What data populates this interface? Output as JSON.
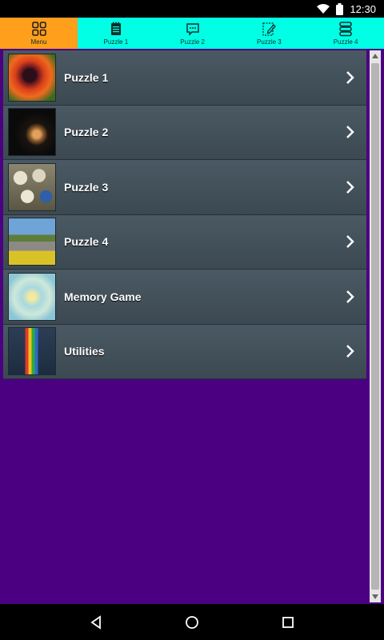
{
  "status_bar": {
    "time": "12:30",
    "icons": [
      "wifi-icon",
      "battery-icon"
    ]
  },
  "tabs": [
    {
      "label": "Menu",
      "icon": "grid-icon",
      "active": true
    },
    {
      "label": "Puzzle 1",
      "icon": "notepad-icon",
      "active": false
    },
    {
      "label": "Puzzle 2",
      "icon": "chat-icon",
      "active": false
    },
    {
      "label": "Puzzle 3",
      "icon": "edit-icon",
      "active": false
    },
    {
      "label": "Puzzle 4",
      "icon": "database-icon",
      "active": false
    }
  ],
  "menu": {
    "items": [
      {
        "label": "Puzzle 1",
        "thumb": "flower-image"
      },
      {
        "label": "Puzzle 2",
        "thumb": "planet-image"
      },
      {
        "label": "Puzzle 3",
        "thumb": "eggs-image"
      },
      {
        "label": "Puzzle 4",
        "thumb": "landscape-image"
      },
      {
        "label": "Memory Game",
        "thumb": "pattern-image"
      },
      {
        "label": "Utilities",
        "thumb": "pencils-image"
      }
    ]
  },
  "nav_bar": {
    "buttons": [
      "back-icon",
      "home-icon",
      "recents-icon"
    ]
  },
  "colors": {
    "tab_bar": "#00ffe5",
    "tab_active": "#ff9f1c",
    "content_bg": "#4b0082",
    "list_item": "#44525b"
  }
}
